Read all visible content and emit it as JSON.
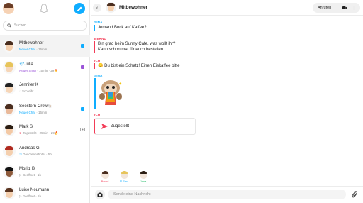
{
  "search": {
    "placeholder": "Suchen"
  },
  "chats": [
    {
      "name": "Mitbewohner",
      "status": "Neuer Chat",
      "time": "· 16min",
      "status_color": "blue",
      "badge": "chat"
    },
    {
      "name": "Julia",
      "status": "Neuer Snap",
      "time": "· 15min · 29",
      "status_color": "purple",
      "badge": "snap",
      "emoji": "🔥"
    },
    {
      "name": "Jennifer K",
      "status": "Schreibt ...",
      "time": "",
      "status_color": "gray",
      "badge": ""
    },
    {
      "name": "Seestern-Crew",
      "status": "Neuer Chat",
      "time": "· 16min",
      "status_color": "blue",
      "badge": "chat"
    },
    {
      "name": "Mark S",
      "status": "Zugestellt",
      "time": "· 25min · 29",
      "status_color": "gray",
      "badge": "camera",
      "emoji": "🔥"
    },
    {
      "name": "Andreas G",
      "status": "Gescreenshotet",
      "time": "· 5h",
      "status_color": "gray",
      "badge": ""
    },
    {
      "name": "Moritz B",
      "status": "Geöffnet",
      "time": "· 1h",
      "status_color": "gray",
      "badge": ""
    },
    {
      "name": "Luise Neumann",
      "status": "Geöffnet",
      "time": "· 1h",
      "status_color": "gray",
      "badge": ""
    }
  ],
  "conversation": {
    "title": "Mitbewohner",
    "call_label": "Anrufen",
    "messages": [
      {
        "sender": "SINA",
        "color": "#0fadff",
        "lines": [
          "Jemand Bock auf Kaffee?"
        ]
      },
      {
        "sender": "BERND",
        "color": "#f23c57",
        "lines": [
          "Bin grad beim Sunny Cafe, was wollt ihr?",
          "Kann schon mal für euch bestellen"
        ]
      },
      {
        "sender": "ICH",
        "color": "#f23c57",
        "lines": [
          "😊 Du bist ein Schatz! Einen Eiskaffee bitte"
        ]
      },
      {
        "sender": "SINA",
        "color": "#0fadff",
        "lines": []
      },
      {
        "sender": "ICH",
        "color": "#f23c57",
        "lines": []
      }
    ],
    "snap_status": "Zugestellt",
    "seen_by": [
      {
        "name": "Bernd",
        "color": "#f23c57"
      },
      {
        "name": "Sina",
        "color": "#0fadff"
      },
      {
        "name": "Jana",
        "color": "#2fbf71"
      }
    ],
    "composer_placeholder": "Sende eine Nachricht"
  },
  "colors": {
    "accent_blue": "#0fadff",
    "accent_red": "#f23c57",
    "accent_purple": "#9b55d8"
  }
}
